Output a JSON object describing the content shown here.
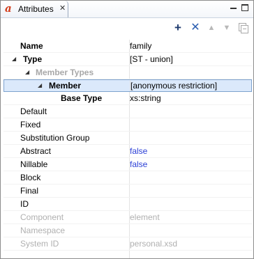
{
  "tab": {
    "title": "Attributes",
    "close": "✕"
  },
  "rows": [
    {
      "name": "Name",
      "value": "family"
    },
    {
      "name": "Type",
      "value": "[ST - union]"
    },
    {
      "name": "Member Types",
      "value": ""
    },
    {
      "name": "Member",
      "value": "[anonymous restriction]"
    },
    {
      "name": "Base Type",
      "value": "xs:string"
    },
    {
      "name": "Default",
      "value": ""
    },
    {
      "name": "Fixed",
      "value": ""
    },
    {
      "name": "Substitution Group",
      "value": ""
    },
    {
      "name": "Abstract",
      "value": "false"
    },
    {
      "name": "Nillable",
      "value": "false"
    },
    {
      "name": "Block",
      "value": ""
    },
    {
      "name": "Final",
      "value": ""
    },
    {
      "name": "ID",
      "value": ""
    },
    {
      "name": "Component",
      "value": "element"
    },
    {
      "name": "Namespace",
      "value": ""
    },
    {
      "name": "System ID",
      "value": "personal.xsd"
    },
    {
      "name": "",
      "value": ""
    }
  ],
  "colors": {
    "selection": "#dbe9fb",
    "link_value": "#2b3fd6",
    "disabled": "#a8a8a8"
  },
  "icons": [
    "app-icon",
    "close-icon",
    "minimize-icon",
    "maximize-icon",
    "add-icon",
    "remove-icon",
    "move-up-icon",
    "move-down-icon",
    "collapse-all-icon",
    "expand-arrow-icon"
  ]
}
